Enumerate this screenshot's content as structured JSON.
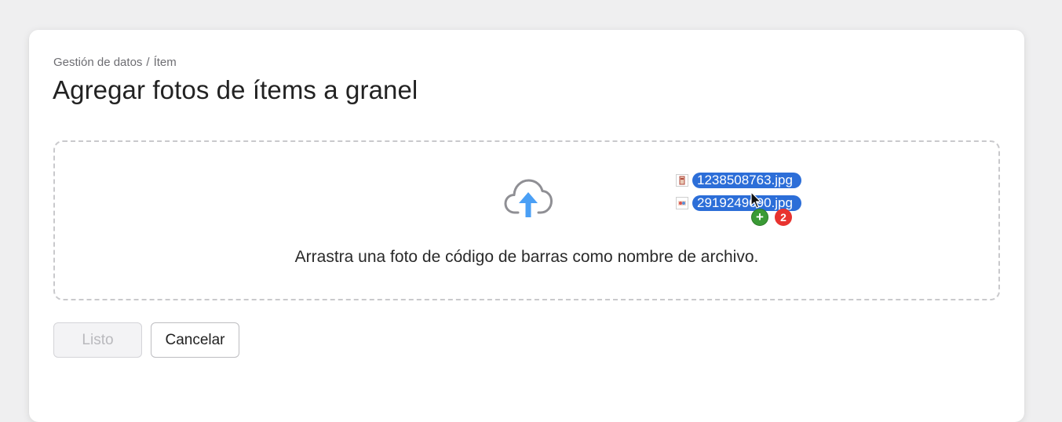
{
  "breadcrumb": {
    "parent": "Gestión de datos",
    "separator": "/",
    "current": "Ítem"
  },
  "page": {
    "title": "Agregar fotos de ítems a granel"
  },
  "dropzone": {
    "icon": "cloud-upload-icon",
    "instruction": "Arrastra una foto de código de barras como nombre de archivo."
  },
  "actions": {
    "done_label": "Listo",
    "cancel_label": "Cancelar"
  },
  "drag": {
    "files": [
      {
        "name": "1238508763.jpg"
      },
      {
        "name": "2919249690.jpg"
      }
    ],
    "copy_symbol": "+",
    "count": "2"
  },
  "colors": {
    "accent_upload": "#4a9ff5",
    "selection": "#2c6ed8",
    "copy_badge": "#3a9a35",
    "count_badge": "#e8332f"
  }
}
